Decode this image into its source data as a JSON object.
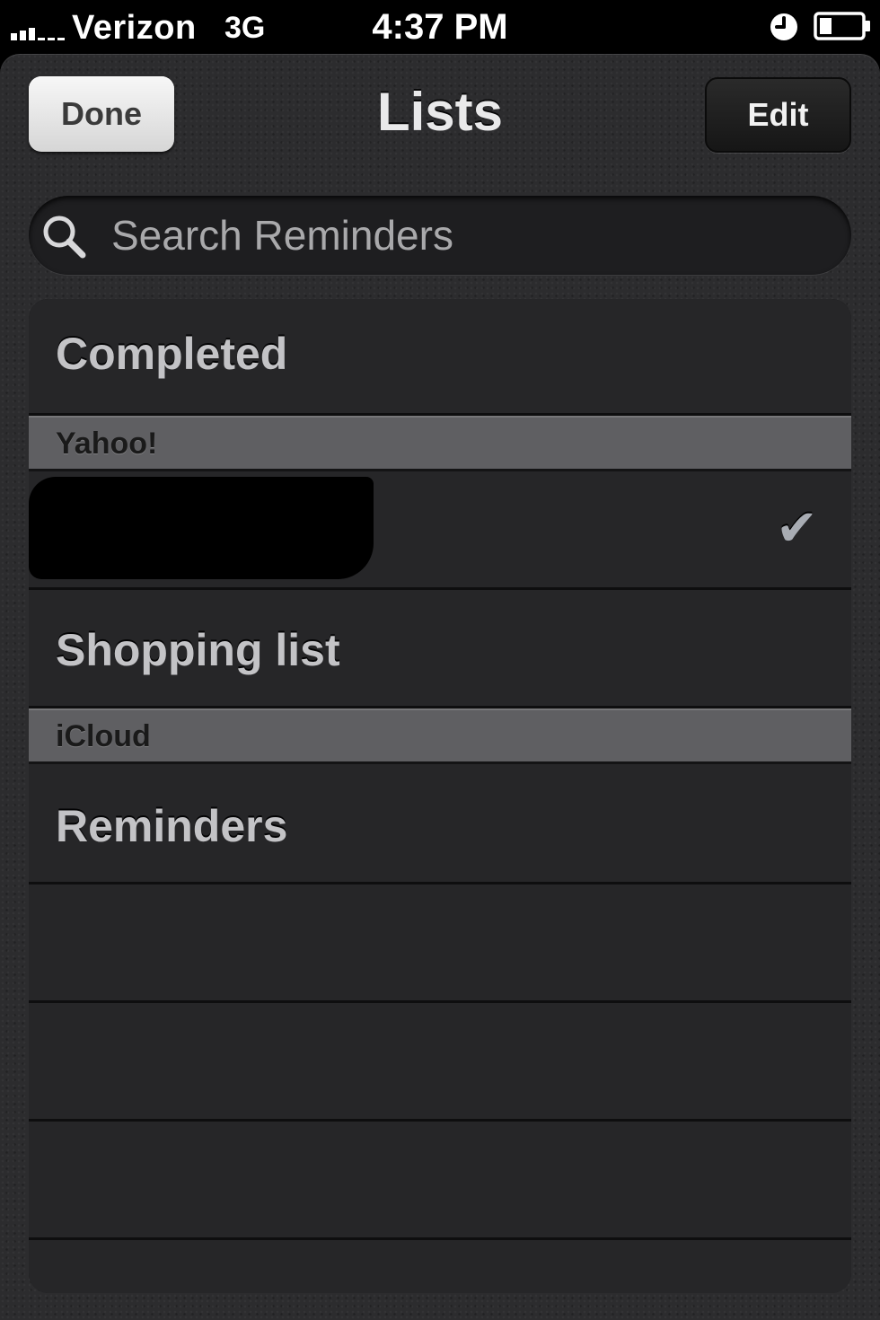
{
  "status_bar": {
    "carrier": "Verizon",
    "network": "3G",
    "time": "4:37 PM",
    "icons": [
      "signal-bars-icon",
      "alarm-clock-icon",
      "battery-icon"
    ],
    "battery_level_percent": 30
  },
  "nav": {
    "title": "Lists",
    "done_label": "Done",
    "edit_label": "Edit"
  },
  "search": {
    "placeholder": "Search Reminders",
    "value": "",
    "icon": "search-icon"
  },
  "list": {
    "completed_label": "Completed",
    "sections": [
      {
        "name": "Yahoo!",
        "items": [
          {
            "label": "",
            "redacted": true,
            "selected": true,
            "check_glyph": "✔"
          },
          {
            "label": "Shopping list"
          }
        ]
      },
      {
        "name": "iCloud",
        "items": [
          {
            "label": "Reminders"
          }
        ]
      }
    ]
  },
  "colors": {
    "leather_background": "#2c2c2e",
    "row_background": "#262628",
    "section_header": "#5f5f62",
    "row_text": "#c3c3c6",
    "checkmark": "#a8acb3"
  }
}
